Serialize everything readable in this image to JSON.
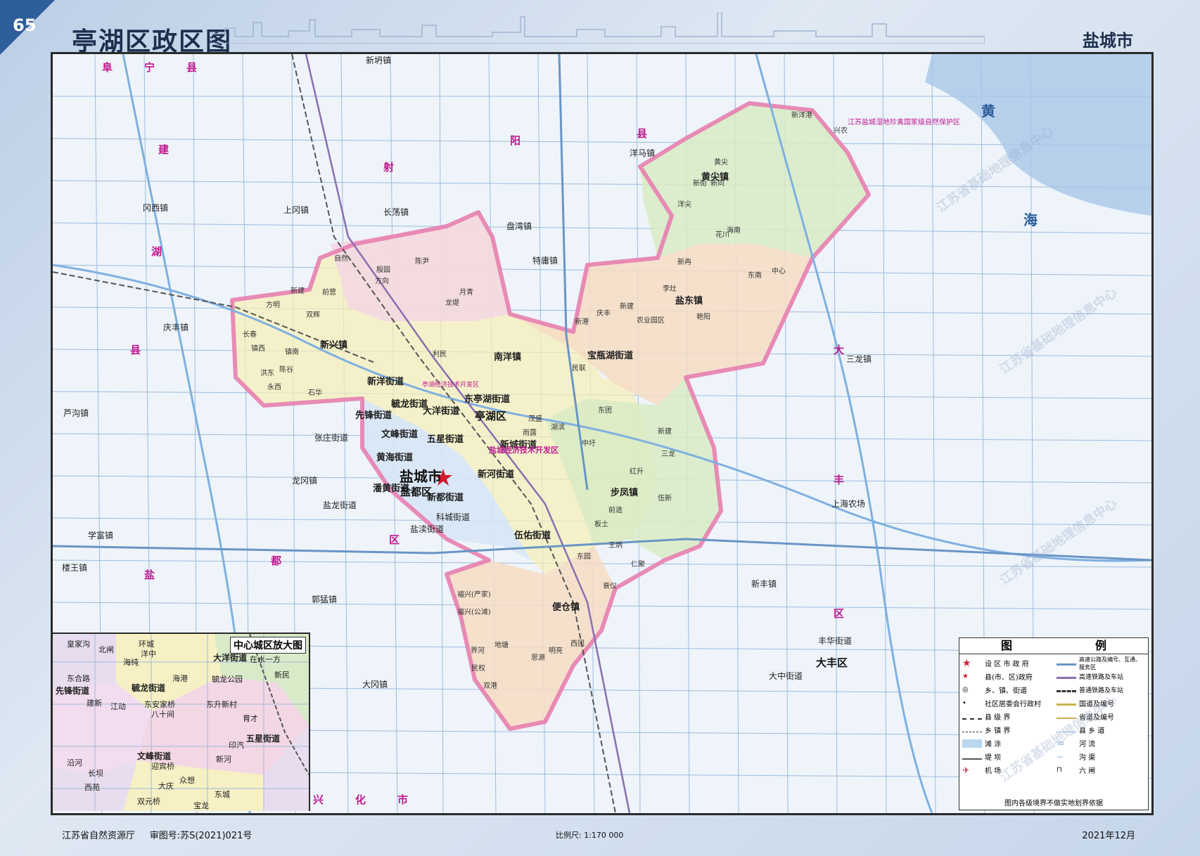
{
  "page": {
    "number": "65",
    "title": "亭湖区政区图",
    "city": "盐城市"
  },
  "colors": {
    "district_border": "#e77fb0",
    "road": "#8aaed3",
    "water": "#b5d4ee",
    "sea": "#9fc4e6",
    "yellow_zone": "#f6f0b5",
    "pink_zone": "#f3d7e4",
    "green_zone": "#d8ebc4",
    "orange_zone": "#f6dcc3",
    "blue_zone": "#d6e6f5"
  },
  "counties": [
    {
      "id": "funing-1",
      "text": "阜"
    },
    {
      "id": "funing-2",
      "text": "宁"
    },
    {
      "id": "funing-3",
      "text": "县"
    },
    {
      "id": "jianhu-1",
      "text": "建"
    },
    {
      "id": "jianhu-2",
      "text": "湖"
    },
    {
      "id": "jianhu-3",
      "text": "县"
    },
    {
      "id": "sheyang-1",
      "text": "射"
    },
    {
      "id": "sheyang-2",
      "text": "阳"
    },
    {
      "id": "sheyang-3",
      "text": "县"
    },
    {
      "id": "yandu-1",
      "text": "盐"
    },
    {
      "id": "yandu-2",
      "text": "都"
    },
    {
      "id": "yandu-3",
      "text": "区"
    },
    {
      "id": "dafeng-1",
      "text": "大"
    },
    {
      "id": "dafeng-2",
      "text": "丰"
    },
    {
      "id": "dafeng-3",
      "text": "区"
    },
    {
      "id": "xinghua-1",
      "text": "兴"
    },
    {
      "id": "xinghua-2",
      "text": "化"
    },
    {
      "id": "xinghua-3",
      "text": "市"
    }
  ],
  "sea": [
    {
      "id": "yellow-1",
      "text": "黄"
    },
    {
      "id": "yellow-2",
      "text": "海"
    }
  ],
  "towns": [
    {
      "id": "xinfang",
      "text": "新坍镇"
    },
    {
      "id": "yangma",
      "text": "洋马镇"
    },
    {
      "id": "panwan",
      "text": "盘湾镇"
    },
    {
      "id": "changdang",
      "text": "长荡镇"
    },
    {
      "id": "shanggang",
      "text": "上冈镇"
    },
    {
      "id": "gangxi",
      "text": "冈西镇"
    },
    {
      "id": "tevong",
      "text": "特庸镇"
    },
    {
      "id": "qingfeng",
      "text": "庆丰镇"
    },
    {
      "id": "sanlong",
      "text": "三龙镇"
    },
    {
      "id": "lugou",
      "text": "芦沟镇"
    },
    {
      "id": "zhangzhuang",
      "text": "张庄街道"
    },
    {
      "id": "longgang",
      "text": "龙冈镇"
    },
    {
      "id": "yanlong",
      "text": "盐龙街道"
    },
    {
      "id": "xuefu",
      "text": "学富镇"
    },
    {
      "id": "louwang",
      "text": "楼王镇"
    },
    {
      "id": "guomeng",
      "text": "郭猛镇"
    },
    {
      "id": "dagang",
      "text": "大冈镇"
    },
    {
      "id": "xinfeng",
      "text": "新丰镇"
    },
    {
      "id": "fenghua",
      "text": "丰华街道"
    },
    {
      "id": "dazhong",
      "text": "大中街道"
    },
    {
      "id": "shanghai",
      "text": "上海农场"
    },
    {
      "id": "yandu-street",
      "text": "盐渎街道"
    },
    {
      "id": "kecheng",
      "text": "科城街道"
    }
  ],
  "district_towns": [
    {
      "id": "huangjian",
      "text": "黄尖镇"
    },
    {
      "id": "yandong",
      "text": "盐东镇"
    },
    {
      "id": "baopinghu",
      "text": "宝瓶湖街道"
    },
    {
      "id": "xinxing",
      "text": "新兴镇"
    },
    {
      "id": "nanyang",
      "text": "南洋镇"
    },
    {
      "id": "xinyang",
      "text": "新洋街道"
    },
    {
      "id": "yulong",
      "text": "毓龙街道"
    },
    {
      "id": "dayang",
      "text": "大洋街道"
    },
    {
      "id": "dongting",
      "text": "东亭湖街道"
    },
    {
      "id": "xianfeng",
      "text": "先锋街道"
    },
    {
      "id": "wenfeng",
      "text": "文峰街道"
    },
    {
      "id": "wuxing",
      "text": "五星街道"
    },
    {
      "id": "xincheng",
      "text": "新城街道"
    },
    {
      "id": "huanghai",
      "text": "黄海街道"
    },
    {
      "id": "xinhe",
      "text": "新河街道"
    },
    {
      "id": "panhuang",
      "text": "潘黄街道"
    },
    {
      "id": "xindu",
      "text": "新都街道"
    },
    {
      "id": "bufeng",
      "text": "步凤镇"
    },
    {
      "id": "wuyou",
      "text": "伍佑街道"
    },
    {
      "id": "biancang",
      "text": "便仓镇"
    }
  ],
  "districts": [
    {
      "id": "tinghu",
      "text": "亭湖区"
    },
    {
      "id": "yandu-d",
      "text": "盐都区"
    },
    {
      "id": "dafeng-d",
      "text": "大丰区"
    }
  ],
  "city_label": "盐城市",
  "small_labels": [
    {
      "id": "s1",
      "text": "新洋港"
    },
    {
      "id": "s2",
      "text": "兴农"
    },
    {
      "id": "s3",
      "text": "黄尖"
    },
    {
      "id": "s4",
      "text": "新街"
    },
    {
      "id": "s5",
      "text": "新同"
    },
    {
      "id": "s6",
      "text": "洋尖"
    },
    {
      "id": "s7",
      "text": "花川"
    },
    {
      "id": "s8",
      "text": "海南"
    },
    {
      "id": "s9",
      "text": "新冉"
    },
    {
      "id": "s10",
      "text": "东南"
    },
    {
      "id": "s11",
      "text": "中心"
    },
    {
      "id": "s12",
      "text": "李灶"
    },
    {
      "id": "s13",
      "text": "新建"
    },
    {
      "id": "s14",
      "text": "庆丰"
    },
    {
      "id": "s15",
      "text": "农业园区"
    },
    {
      "id": "s16",
      "text": "艳阳"
    },
    {
      "id": "s17",
      "text": "自然"
    },
    {
      "id": "s18",
      "text": "殷园"
    },
    {
      "id": "s19",
      "text": "陈尹"
    },
    {
      "id": "s20",
      "text": "方向"
    },
    {
      "id": "s21",
      "text": "新建"
    },
    {
      "id": "s22",
      "text": "前营"
    },
    {
      "id": "s23",
      "text": "方明"
    },
    {
      "id": "s24",
      "text": "双辉"
    },
    {
      "id": "s25",
      "text": "长春"
    },
    {
      "id": "s26",
      "text": "镇西"
    },
    {
      "id": "s27",
      "text": "镇南"
    },
    {
      "id": "s28",
      "text": "洪东"
    },
    {
      "id": "s29",
      "text": "永西"
    },
    {
      "id": "s30",
      "text": "陈谷"
    },
    {
      "id": "s31",
      "text": "石华"
    },
    {
      "id": "s32",
      "text": "龙堤"
    },
    {
      "id": "s33",
      "text": "月青"
    },
    {
      "id": "s34",
      "text": "利民"
    },
    {
      "id": "s35",
      "text": "民联"
    },
    {
      "id": "s36",
      "text": "新港"
    },
    {
      "id": "s37",
      "text": "东团"
    },
    {
      "id": "s38",
      "text": "新建"
    },
    {
      "id": "s39",
      "text": "三龙"
    },
    {
      "id": "s40",
      "text": "红升"
    },
    {
      "id": "s41",
      "text": "伍新"
    },
    {
      "id": "s42",
      "text": "前途"
    },
    {
      "id": "s43",
      "text": "板士"
    },
    {
      "id": "s44",
      "text": "王炳"
    },
    {
      "id": "s45",
      "text": "仁聚"
    },
    {
      "id": "s46",
      "text": "东园"
    },
    {
      "id": "s47",
      "text": "衰仪"
    },
    {
      "id": "s48",
      "text": "福兴(严家)"
    },
    {
      "id": "s49",
      "text": "福兴(公滩)"
    },
    {
      "id": "s50",
      "text": "界河"
    },
    {
      "id": "s51",
      "text": "地塘"
    },
    {
      "id": "s52",
      "text": "民权"
    },
    {
      "id": "s53",
      "text": "双港"
    },
    {
      "id": "s54",
      "text": "思源"
    },
    {
      "id": "s55",
      "text": "明亮"
    },
    {
      "id": "s56",
      "text": "西团"
    },
    {
      "id": "s57",
      "text": "湖滨"
    },
    {
      "id": "s58",
      "text": "雨露"
    },
    {
      "id": "s59",
      "text": "茂盛"
    },
    {
      "id": "s60",
      "text": "中圩"
    }
  ],
  "zone_labels": [
    {
      "id": "z1",
      "text": "江苏盐城湿地珍禽国家级自然保护区"
    },
    {
      "id": "z2",
      "text": "盐城经济技术开发区"
    },
    {
      "id": "z3",
      "text": "亭湖经济技术开发区"
    }
  ],
  "inset": {
    "title": "中心城区放大图",
    "labels": [
      {
        "id": "i1",
        "text": "皇家沟"
      },
      {
        "id": "i2",
        "text": "北闸"
      },
      {
        "id": "i3",
        "text": "环城"
      },
      {
        "id": "i4",
        "text": "洋中"
      },
      {
        "id": "i5",
        "text": "大洋街道"
      },
      {
        "id": "i6",
        "text": "在水一方"
      },
      {
        "id": "i7",
        "text": "东合路"
      },
      {
        "id": "i8",
        "text": "海纯"
      },
      {
        "id": "i9",
        "text": "先锋街道"
      },
      {
        "id": "i10",
        "text": "毓龙街道"
      },
      {
        "id": "i11",
        "text": "毓龙公园"
      },
      {
        "id": "i12",
        "text": "海港"
      },
      {
        "id": "i13",
        "text": "新民"
      },
      {
        "id": "i14",
        "text": "建新"
      },
      {
        "id": "i15",
        "text": "江动"
      },
      {
        "id": "i16",
        "text": "东安家桥"
      },
      {
        "id": "i17",
        "text": "八十间"
      },
      {
        "id": "i18",
        "text": "东升新村"
      },
      {
        "id": "i19",
        "text": "育才"
      },
      {
        "id": "i20",
        "text": "五星街道"
      },
      {
        "id": "i21",
        "text": "文峰街道"
      },
      {
        "id": "i22",
        "text": "迎宾桥"
      },
      {
        "id": "i23",
        "text": "印汽"
      },
      {
        "id": "i24",
        "text": "新河"
      },
      {
        "id": "i25",
        "text": "沿河"
      },
      {
        "id": "i26",
        "text": "长坝"
      },
      {
        "id": "i27",
        "text": "西苑"
      },
      {
        "id": "i28",
        "text": "大庆"
      },
      {
        "id": "i29",
        "text": "双元桥"
      },
      {
        "id": "i30",
        "text": "众想"
      },
      {
        "id": "i31",
        "text": "东城"
      },
      {
        "id": "i32",
        "text": "宝龙"
      }
    ]
  },
  "legend": {
    "title_left": "图",
    "title_right": "例",
    "left_items": [
      {
        "id": "l1",
        "text": "设 区 市 政 府",
        "icon": "star-large-icon"
      },
      {
        "id": "l2",
        "text": "县(市、区)政府",
        "icon": "star-small-icon"
      },
      {
        "id": "l3",
        "text": "乡、镇、街道",
        "icon": "circle-icon"
      },
      {
        "id": "l4",
        "text": "社区居委会行政村",
        "icon": "dot-icon"
      },
      {
        "id": "l5",
        "text": "县 级 界",
        "icon": "dashdot-line-icon"
      },
      {
        "id": "l6",
        "text": "乡 镇 界",
        "icon": "dash-line-icon"
      },
      {
        "id": "l7",
        "text": "滩 涂",
        "icon": "mudflat-icon"
      },
      {
        "id": "l8",
        "text": "堤 坝",
        "icon": "dam-icon"
      },
      {
        "id": "l9",
        "text": "机 场",
        "icon": "airport-icon"
      }
    ],
    "right_items": [
      {
        "id": "r1",
        "text": "高速公路及编号、互通、服务区",
        "icon": "expressway-icon"
      },
      {
        "id": "r2",
        "text": "高速铁路及车站",
        "icon": "hsr-icon"
      },
      {
        "id": "r3",
        "text": "普通铁路及车站",
        "icon": "railway-icon"
      },
      {
        "id": "r4",
        "text": "国道及编号",
        "icon": "national-road-icon"
      },
      {
        "id": "r5",
        "text": "省道及编号",
        "icon": "provincial-road-icon"
      },
      {
        "id": "r6",
        "text": "县 乡 道",
        "icon": "county-road-icon"
      },
      {
        "id": "r7",
        "text": "河 流",
        "icon": "river-icon"
      },
      {
        "id": "r8",
        "text": "沟 渠",
        "icon": "canal-icon"
      },
      {
        "id": "r9",
        "text": "六 闸",
        "icon": "sluice-icon"
      }
    ],
    "note": "图内各级境界不做实地划界依据"
  },
  "footer": {
    "publisher": "江苏省自然资源厅",
    "approval": "审图号:苏S(2021)021号",
    "scale": "比例尺: 1:170 000",
    "date": "2021年12月"
  },
  "watermark_text": "江苏省基础地理信息中心"
}
